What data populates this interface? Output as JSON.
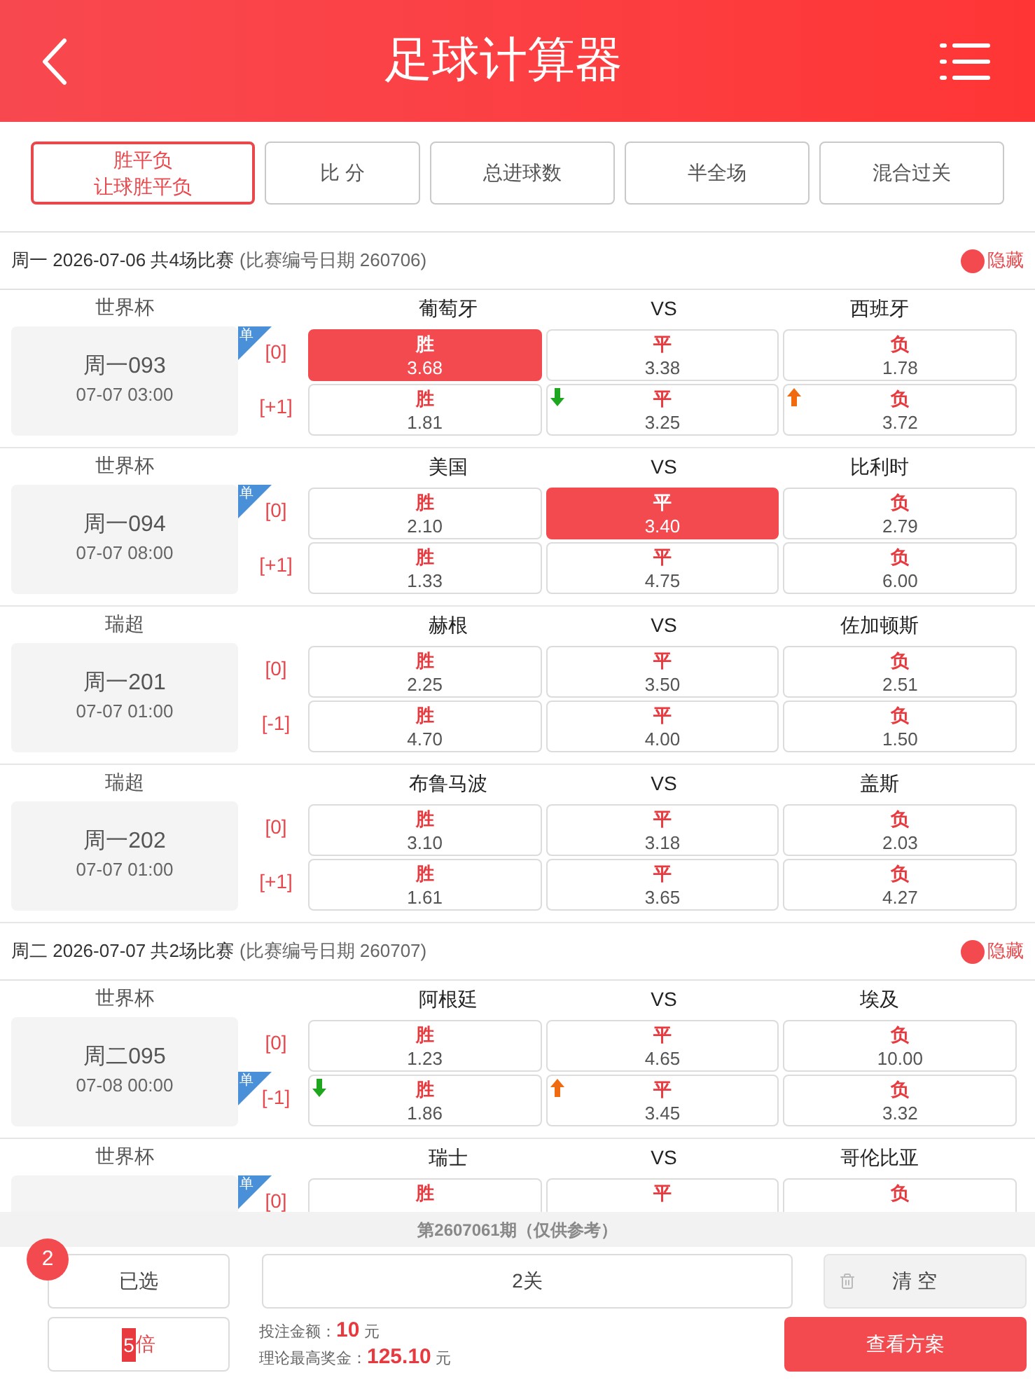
{
  "header": {
    "title": "足球计算器"
  },
  "tabs": [
    {
      "lines": [
        "胜平负",
        "让球胜平负"
      ],
      "selected": true
    },
    {
      "lines": [
        "比 分"
      ],
      "selected": false
    },
    {
      "lines": [
        "总进球数"
      ],
      "selected": false
    },
    {
      "lines": [
        "半全场"
      ],
      "selected": false
    },
    {
      "lines": [
        "混合过关"
      ],
      "selected": false
    }
  ],
  "days": [
    {
      "title": "周一 2026-07-06 共4场比赛",
      "note": "(比赛编号日期 260706)",
      "hide_label": "隐藏",
      "matches": [
        {
          "league": "世界杯",
          "code": "周一093",
          "time": "07-07 03:00",
          "home": "葡萄牙",
          "vs": "VS",
          "away": "西班牙",
          "lines": [
            {
              "badge": "单",
              "handicap": "[0]",
              "odds": [
                {
                  "kind": "plain",
                  "label": "胜",
                  "value": "3.68",
                  "selected": true
                },
                {
                  "kind": "plain",
                  "label": "平",
                  "value": "3.38",
                  "selected": false
                },
                {
                  "kind": "plain",
                  "label": "负",
                  "value": "1.78",
                  "selected": false
                }
              ]
            },
            {
              "handicap": "[+1]",
              "odds": [
                {
                  "kind": "plain",
                  "label": "胜",
                  "value": "1.81",
                  "selected": false
                },
                {
                  "kind": "falling",
                  "label": "平",
                  "value": "3.25",
                  "selected": false
                },
                {
                  "kind": "rising",
                  "label": "负",
                  "value": "3.72",
                  "selected": false
                }
              ]
            }
          ]
        },
        {
          "league": "世界杯",
          "code": "周一094",
          "time": "07-07 08:00",
          "home": "美国",
          "vs": "VS",
          "away": "比利时",
          "lines": [
            {
              "badge": "单",
              "handicap": "[0]",
              "odds": [
                {
                  "kind": "plain",
                  "label": "胜",
                  "value": "2.10",
                  "selected": false
                },
                {
                  "kind": "plain",
                  "label": "平",
                  "value": "3.40",
                  "selected": true
                },
                {
                  "kind": "plain",
                  "label": "负",
                  "value": "2.79",
                  "selected": false
                }
              ]
            },
            {
              "handicap": "[+1]",
              "odds": [
                {
                  "kind": "plain",
                  "label": "胜",
                  "value": "1.33",
                  "selected": false
                },
                {
                  "kind": "plain",
                  "label": "平",
                  "value": "4.75",
                  "selected": false
                },
                {
                  "kind": "plain",
                  "label": "负",
                  "value": "6.00",
                  "selected": false
                }
              ]
            }
          ]
        },
        {
          "league": "瑞超",
          "code": "周一201",
          "time": "07-07 01:00",
          "home": "赫根",
          "vs": "VS",
          "away": "佐加顿斯",
          "lines": [
            {
              "handicap": "[0]",
              "odds": [
                {
                  "kind": "plain",
                  "label": "胜",
                  "value": "2.25",
                  "selected": false
                },
                {
                  "kind": "plain",
                  "label": "平",
                  "value": "3.50",
                  "selected": false
                },
                {
                  "kind": "plain",
                  "label": "负",
                  "value": "2.51",
                  "selected": false
                }
              ]
            },
            {
              "handicap": "[-1]",
              "odds": [
                {
                  "kind": "plain",
                  "label": "胜",
                  "value": "4.70",
                  "selected": false
                },
                {
                  "kind": "plain",
                  "label": "平",
                  "value": "4.00",
                  "selected": false
                },
                {
                  "kind": "plain",
                  "label": "负",
                  "value": "1.50",
                  "selected": false
                }
              ]
            }
          ]
        },
        {
          "league": "瑞超",
          "code": "周一202",
          "time": "07-07 01:00",
          "home": "布鲁马波",
          "vs": "VS",
          "away": "盖斯",
          "lines": [
            {
              "handicap": "[0]",
              "odds": [
                {
                  "kind": "plain",
                  "label": "胜",
                  "value": "3.10",
                  "selected": false
                },
                {
                  "kind": "plain",
                  "label": "平",
                  "value": "3.18",
                  "selected": false
                },
                {
                  "kind": "plain",
                  "label": "负",
                  "value": "2.03",
                  "selected": false
                }
              ]
            },
            {
              "handicap": "[+1]",
              "odds": [
                {
                  "kind": "plain",
                  "label": "胜",
                  "value": "1.61",
                  "selected": false
                },
                {
                  "kind": "plain",
                  "label": "平",
                  "value": "3.65",
                  "selected": false
                },
                {
                  "kind": "plain",
                  "label": "负",
                  "value": "4.27",
                  "selected": false
                }
              ]
            }
          ]
        }
      ]
    },
    {
      "title": "周二 2026-07-07 共2场比赛",
      "note": "(比赛编号日期 260707)",
      "hide_label": "隐藏",
      "matches": [
        {
          "league": "世界杯",
          "code": "周二095",
          "time": "07-08 00:00",
          "home": "阿根廷",
          "vs": "VS",
          "away": "埃及",
          "lines": [
            {
              "handicap": "[0]",
              "odds": [
                {
                  "kind": "plain",
                  "label": "胜",
                  "value": "1.23",
                  "selected": false
                },
                {
                  "kind": "plain",
                  "label": "平",
                  "value": "4.65",
                  "selected": false
                },
                {
                  "kind": "plain",
                  "label": "负",
                  "value": "10.00",
                  "selected": false
                }
              ]
            },
            {
              "badge": "单",
              "handicap": "[-1]",
              "odds": [
                {
                  "kind": "falling",
                  "label": "胜",
                  "value": "1.86",
                  "selected": false
                },
                {
                  "kind": "rising",
                  "label": "平",
                  "value": "3.45",
                  "selected": false
                },
                {
                  "kind": "plain",
                  "label": "负",
                  "value": "3.32",
                  "selected": false
                }
              ]
            }
          ]
        },
        {
          "league": "世界杯",
          "home": "瑞士",
          "vs": "VS",
          "away": "哥伦比亚",
          "lines": [
            {
              "badge": "单",
              "handicap": "[0]",
              "odds": [
                {
                  "kind": "plain",
                  "label": "胜",
                  "selected": false
                },
                {
                  "kind": "plain",
                  "label": "平",
                  "selected": false
                },
                {
                  "kind": "plain",
                  "label": "负",
                  "selected": false
                }
              ]
            }
          ]
        }
      ]
    }
  ],
  "footer": {
    "period_note": "第2607061期（仅供参考）",
    "picked": {
      "label": "已选",
      "count": "2"
    },
    "pass_type": "2关",
    "clear": "清 空",
    "multiplier": {
      "value": "5",
      "unit": "倍"
    },
    "bet": {
      "label": "投注金额：",
      "amount": "10",
      "unit": "元"
    },
    "prize": {
      "label": "理论最高奖金：",
      "amount": "125.10",
      "unit": "元"
    },
    "submit": "查看方案"
  }
}
